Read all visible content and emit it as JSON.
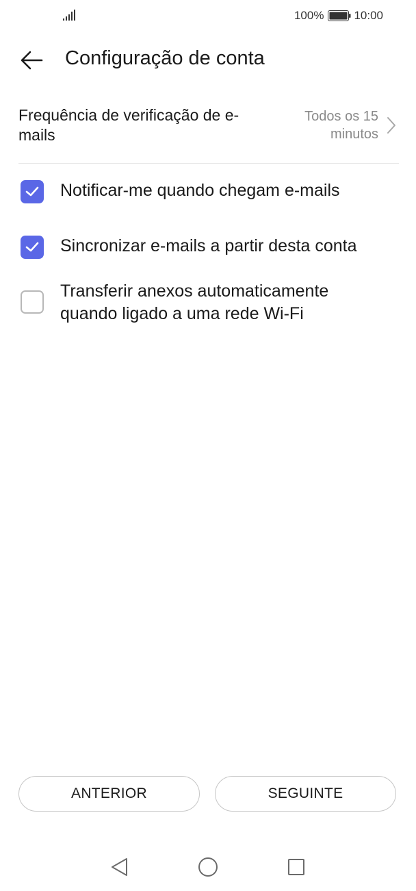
{
  "status_bar": {
    "battery_percent": "100%",
    "time": "10:00",
    "icons": [
      "signal-icon",
      "battery-icon"
    ]
  },
  "header": {
    "title": "Configuração de conta",
    "back_icon": "arrow-left-icon"
  },
  "frequency": {
    "label": "Frequência de verificação de e-mails",
    "value": "Todos os 15 minutos"
  },
  "options": [
    {
      "label": "Notificar-me quando chegam e-mails",
      "checked": true
    },
    {
      "label": "Sincronizar e-mails a partir desta conta",
      "checked": true
    },
    {
      "label": "Transferir anexos automaticamente quando ligado a uma rede Wi-Fi",
      "checked": false
    }
  ],
  "buttons": {
    "previous": "ANTERIOR",
    "next": "SEGUINTE"
  },
  "nav_bar": {
    "icons": [
      "back-triangle-icon",
      "home-circle-icon",
      "recents-square-icon"
    ]
  },
  "colors": {
    "accent": "#5a67e6",
    "text": "#1a1a1a",
    "secondary_text": "#8a8a8a",
    "divider": "#e6e6e6"
  }
}
